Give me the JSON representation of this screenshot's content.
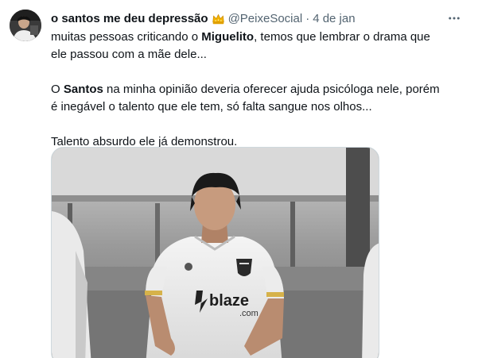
{
  "tweet": {
    "display_name": "o santos me deu depressão",
    "handle": "@PeixeSocial",
    "separator": "·",
    "timestamp": "4 de jan",
    "badge_icon": "crown-icon",
    "more_icon": "more-options-icon",
    "paragraph1": {
      "part1": "muitas pessoas criticando o ",
      "bold1": "Miguelito",
      "part2": ", temos que lembrar o drama que ele passou com a mãe dele..."
    },
    "paragraph2": {
      "part1": "O ",
      "bold1": "Santos",
      "part2": " na minha opinião deveria oferecer ajuda psicóloga nele, porém é inegável o talento que ele tem, só falta sangue nos olhos..."
    },
    "paragraph3": "Talento absurdo ele já demonstrou.",
    "media": {
      "sponsor_brand": "blaze",
      "sponsor_suffix": ".com"
    }
  },
  "colors": {
    "text_primary": "#0f1419",
    "text_secondary": "#536471",
    "border": "#cfd9de",
    "badge_gold": "#f4b400"
  }
}
